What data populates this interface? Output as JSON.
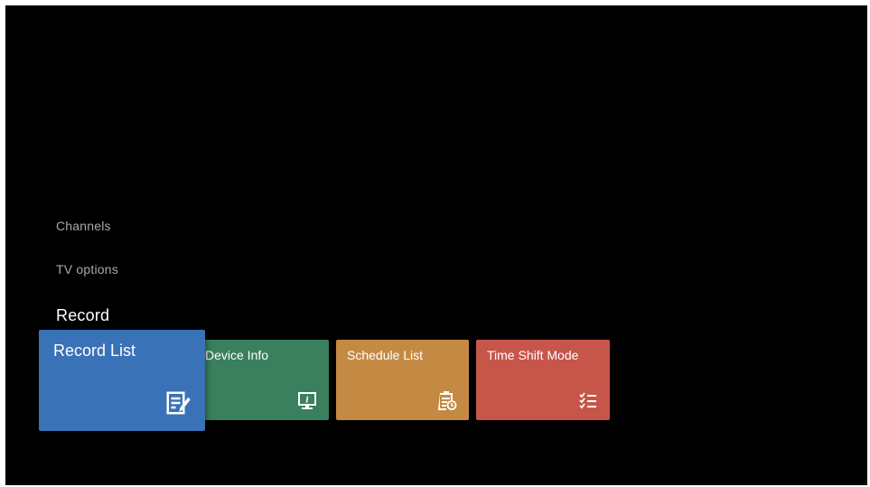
{
  "menu": {
    "items": [
      {
        "label": "Channels"
      },
      {
        "label": "TV options"
      },
      {
        "label": "Record"
      }
    ],
    "selected": "Record"
  },
  "tiles": [
    {
      "label": "Record List",
      "icon": "record-list-icon",
      "color": "#3a72b8",
      "focused": true
    },
    {
      "label": "Device Info",
      "icon": "device-info-icon",
      "color": "#3a7f5e"
    },
    {
      "label": "Schedule List",
      "icon": "schedule-list-icon",
      "color": "#c48a43"
    },
    {
      "label": "Time Shift Mode",
      "icon": "time-shift-icon",
      "color": "#c6554a"
    }
  ]
}
